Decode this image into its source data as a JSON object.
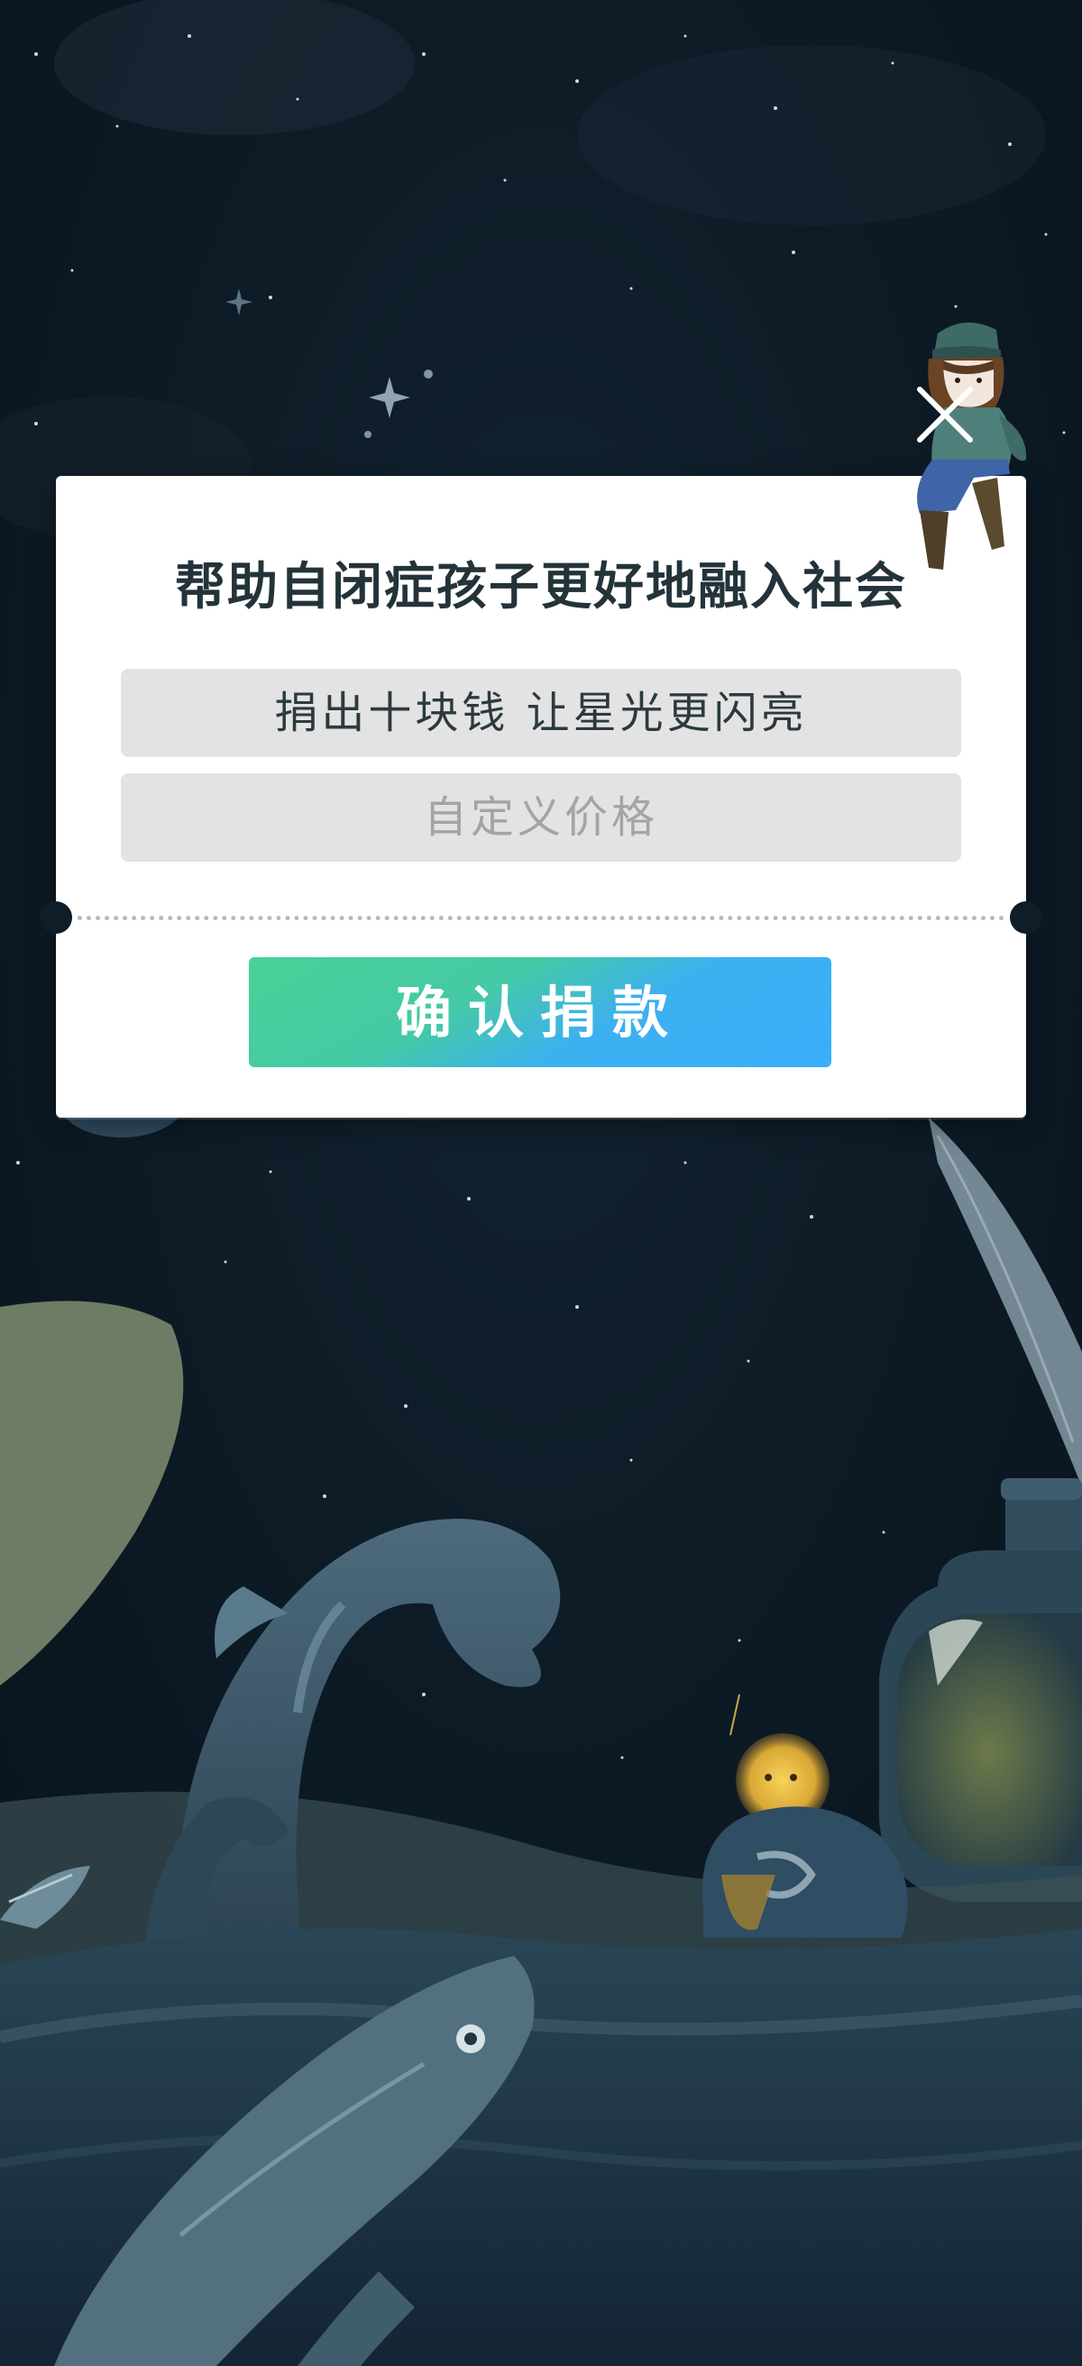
{
  "modal": {
    "title": "帮助自闭症孩子更好地融入社会",
    "preset_option": "捐出十块钱 让星光更闪亮",
    "custom_placeholder": "自定义价格",
    "confirm_label": "确认捐款"
  },
  "icons": {
    "close": "close-icon"
  },
  "colors": {
    "background": "#0b1722",
    "title": "#24333a",
    "option_bg": "#e3e3e3",
    "button_gradient_start": "#49d196",
    "button_gradient_end": "#3aaefa"
  }
}
